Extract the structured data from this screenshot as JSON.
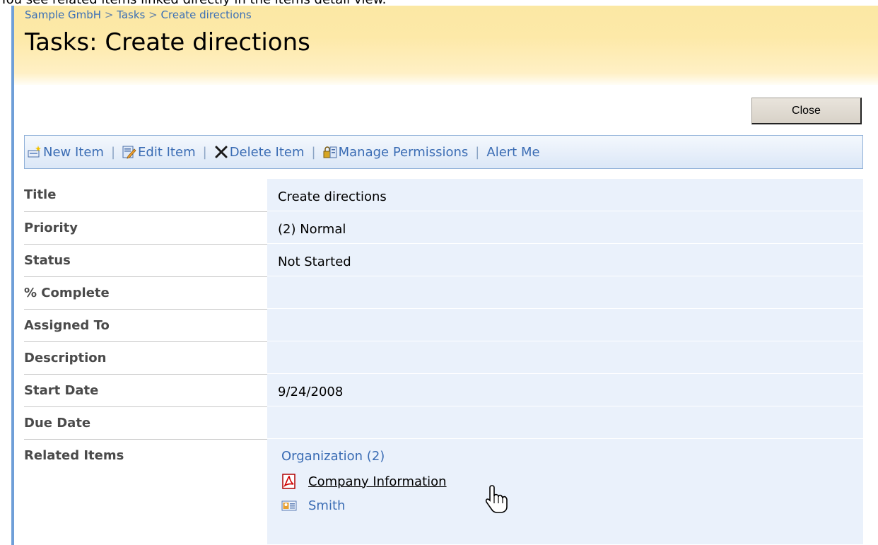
{
  "caption": "You see related items linked directly in the items detail view.",
  "breadcrumb": {
    "site": "Sample GmbH",
    "list": "Tasks",
    "item": "Create directions",
    "separator": ">"
  },
  "page_title": "Tasks: Create directions",
  "close_label": "Close",
  "toolbar": {
    "new_item": "New Item",
    "edit_item": "Edit Item",
    "delete_item": "Delete Item",
    "manage_permissions": "Manage Permissions",
    "alert_me": "Alert Me",
    "separator": "|"
  },
  "fields": [
    {
      "label": "Title",
      "value": "Create directions"
    },
    {
      "label": "Priority",
      "value": "(2) Normal"
    },
    {
      "label": "Status",
      "value": "Not Started"
    },
    {
      "label": "% Complete",
      "value": ""
    },
    {
      "label": "Assigned To",
      "value": ""
    },
    {
      "label": "Description",
      "value": ""
    },
    {
      "label": "Start Date",
      "value": "9/24/2008"
    },
    {
      "label": "Due Date",
      "value": ""
    }
  ],
  "related": {
    "label": "Related Items",
    "group": "Organization (2)",
    "items": [
      {
        "title": "Company Information",
        "icon": "pdf-icon"
      },
      {
        "title": "Smith",
        "icon": "contact-card-icon"
      }
    ]
  }
}
